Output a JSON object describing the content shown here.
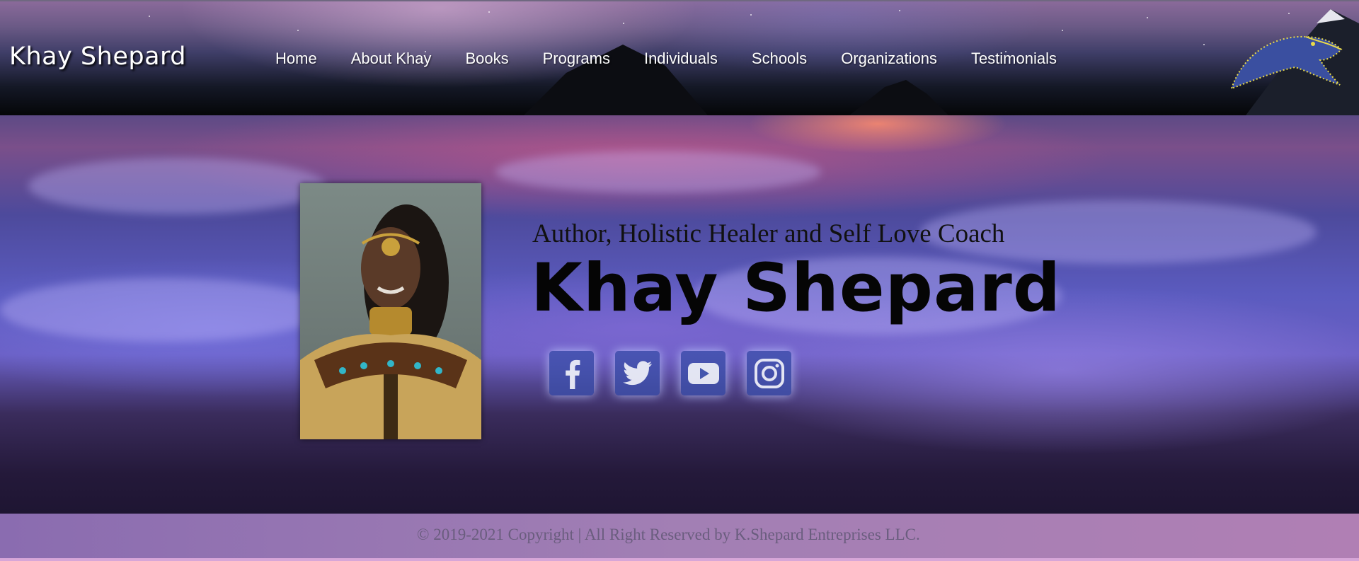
{
  "header": {
    "brand": "Khay Shepard",
    "nav": [
      "Home",
      "About Khay",
      "Books",
      "Programs",
      "Individuals",
      "Schools",
      "Organizations",
      "Testimonials"
    ],
    "logo_icon": "whale-logo-icon"
  },
  "hero": {
    "tagline": "Author, Holistic Healer and Self Love Coach",
    "name": "Khay Shepard",
    "portrait_icon": "portrait-photo",
    "social": [
      {
        "name": "facebook-icon"
      },
      {
        "name": "twitter-icon"
      },
      {
        "name": "youtube-icon"
      },
      {
        "name": "instagram-icon"
      }
    ]
  },
  "footer": {
    "copyright": "© 2019-2021 Copyright | All Right Reserved by K.Shepard Entreprises LLC."
  },
  "colors": {
    "social_button": "#3c50aa",
    "footer_bg": "#a27fb4",
    "footer_text": "#6a5d7e"
  }
}
